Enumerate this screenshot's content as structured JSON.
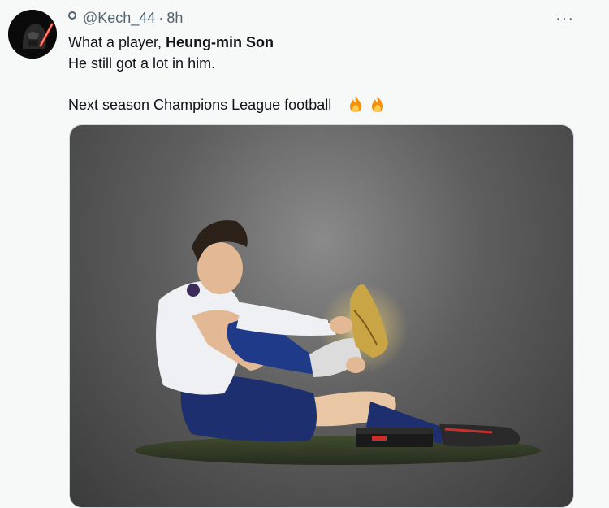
{
  "tweet": {
    "handle": "@Kech_44",
    "separator": "·",
    "time": "8h",
    "more_label": "···",
    "line1_prefix": "What a player, ",
    "line1_bold": "Heung-min Son",
    "line2": "He still got a lot in him.",
    "line3": "Next season Champions League football",
    "emoji": [
      "fire-icon",
      "fire-icon"
    ]
  },
  "colors": {
    "background": "#f7f9f9",
    "secondary_text": "#536471",
    "kit_navy": "#1d2f6e"
  }
}
